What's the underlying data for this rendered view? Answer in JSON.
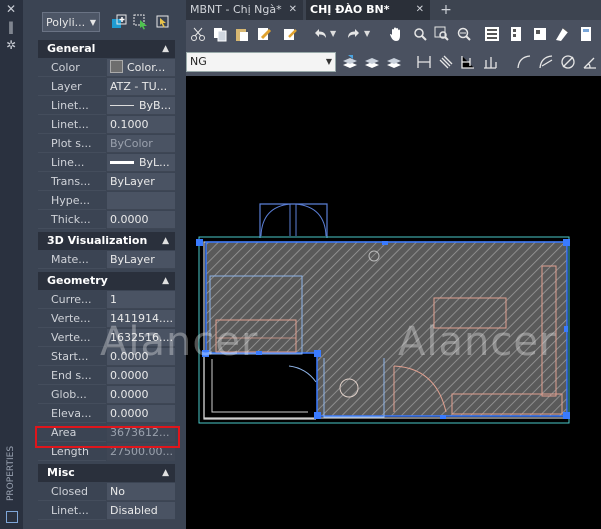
{
  "palette": {
    "object_type": "Polyli...",
    "sections": [
      {
        "title": "General",
        "rows": [
          {
            "name": "Color",
            "value": "Color..."
          },
          {
            "name": "Layer",
            "value": "ATZ - TU..."
          },
          {
            "name": "Linet...",
            "value": "ByB..."
          },
          {
            "name": "Linet...",
            "value": "0.1000"
          },
          {
            "name": "Plot s...",
            "value": "ByColor"
          },
          {
            "name": "Line...",
            "value": "ByL..."
          },
          {
            "name": "Trans...",
            "value": "ByLayer"
          },
          {
            "name": "Hype...",
            "value": ""
          },
          {
            "name": "Thick...",
            "value": "0.0000"
          }
        ]
      },
      {
        "title": "3D Visualization",
        "rows": [
          {
            "name": "Mate...",
            "value": "ByLayer"
          }
        ]
      },
      {
        "title": "Geometry",
        "rows": [
          {
            "name": "Curre...",
            "value": "1"
          },
          {
            "name": "Verte...",
            "value": "1411914...."
          },
          {
            "name": "Verte...",
            "value": "1632516...."
          },
          {
            "name": "Start...",
            "value": "0.0000"
          },
          {
            "name": "End s...",
            "value": "0.0000"
          },
          {
            "name": "Glob...",
            "value": "0.0000"
          },
          {
            "name": "Eleva...",
            "value": "0.0000"
          },
          {
            "name": "Area",
            "value": "3673612..."
          },
          {
            "name": "Length",
            "value": "27500.00..."
          }
        ]
      },
      {
        "title": "Misc",
        "rows": [
          {
            "name": "Closed",
            "value": "No"
          },
          {
            "name": "Linet...",
            "value": "Disabled"
          }
        ]
      }
    ],
    "side_label": "PROPERTIES"
  },
  "tabs": [
    {
      "label": "MBNT - Chị Ngà*"
    },
    {
      "label": "CHỊ ĐÀO BN*"
    }
  ],
  "ribbon": {
    "layer_value": "NG"
  },
  "watermark": [
    "Alancer",
    "Alancer"
  ],
  "colors": {
    "highlight": "#e0151b",
    "polyline_selection": "#3a7bff",
    "hatch": "#8a8a8a",
    "walls": "#d8d8d8",
    "furniture": "#e0a090"
  },
  "icons": [
    "close-icon",
    "gear-icon",
    "quick-select-icon",
    "select-objects-icon",
    "pan-hand-icon",
    "undo-icon",
    "redo-icon"
  ]
}
